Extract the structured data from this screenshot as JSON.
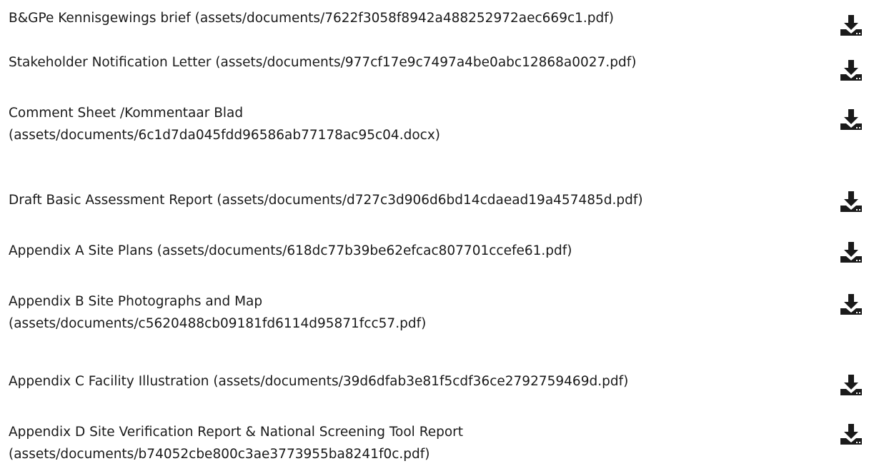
{
  "documents": [
    {
      "title": "B&GPe Kennisgewings brief (assets/documents/7622f3058f8942a488252972aec669c1.pdf)",
      "action_icon": "download-icon"
    },
    {
      "title": "Stakeholder Notification Letter (assets/documents/977cf17e9c7497a4be0abc12868a0027.pdf)",
      "action_icon": "download-icon"
    },
    {
      "title": "Comment Sheet /Kommentaar Blad (assets/documents/6c1d7da045fdd96586ab77178ac95c04.docx)",
      "action_icon": "download-icon"
    },
    {
      "title": "Draft Basic Assessment Report (assets/documents/d727c3d906d6bd14cdaead19a457485d.pdf)",
      "action_icon": "download-icon"
    },
    {
      "title": "Appendix A Site Plans (assets/documents/618dc77b39be62efcac807701ccefe61.pdf)",
      "action_icon": "download-icon"
    },
    {
      "title": "Appendix B Site Photographs and Map (assets/documents/c5620488cb09181fd6114d95871fcc57.pdf)",
      "action_icon": "download-icon"
    },
    {
      "title": "Appendix C Facility Illustration (assets/documents/39d6dfab3e81f5cdf36ce2792759469d.pdf)",
      "action_icon": "download-icon"
    },
    {
      "title": "Appendix D Site Verification Report & National Screening Tool Report (assets/documents/b74052cbe800c3ae3773955ba8241f0c.pdf)",
      "action_icon": "download-icon"
    }
  ],
  "colors": {
    "text": "#1a1a1a",
    "icon": "#1a1a1a",
    "background": "#ffffff"
  }
}
